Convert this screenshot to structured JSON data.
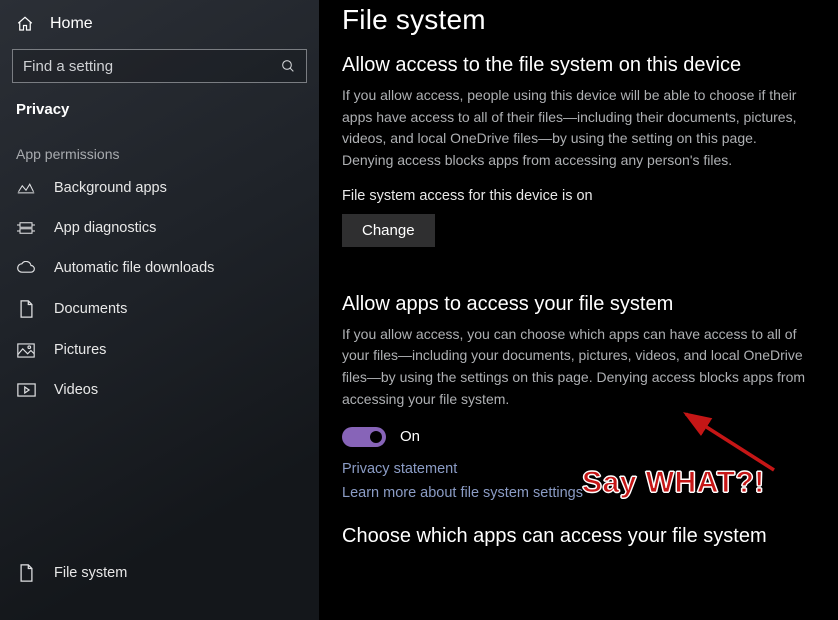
{
  "sidebar": {
    "home": "Home",
    "search_placeholder": "Find a setting",
    "category": "Privacy",
    "group": "App permissions",
    "items": [
      {
        "label": "Background apps",
        "icon": "background-apps-icon"
      },
      {
        "label": "App diagnostics",
        "icon": "diagnostics-icon"
      },
      {
        "label": "Automatic file downloads",
        "icon": "cloud-icon"
      },
      {
        "label": "Documents",
        "icon": "document-icon"
      },
      {
        "label": "Pictures",
        "icon": "pictures-icon"
      },
      {
        "label": "Videos",
        "icon": "videos-icon"
      }
    ],
    "selected": {
      "label": "File system",
      "icon": "document-icon"
    }
  },
  "main": {
    "title": "File system",
    "section1": {
      "heading": "Allow access to the file system on this device",
      "body": "If you allow access, people using this device will be able to choose if their apps have access to all of their files—including their documents, pictures, videos, and local OneDrive files—by using the setting on this page. Denying access blocks apps from accessing any person's files.",
      "status": "File system access for this device is on",
      "button": "Change"
    },
    "section2": {
      "heading": "Allow apps to access your file system",
      "body": "If you allow access, you can choose which apps can have access to all of your files—including your documents, pictures, videos, and local OneDrive files—by using the settings on this page. Denying access blocks apps from accessing your file system.",
      "toggle_label": "On",
      "link_privacy": "Privacy statement",
      "link_learn": "Learn more about file system settings"
    },
    "section3": {
      "heading": "Choose which apps can access your file system"
    }
  },
  "annotation": {
    "text": "Say WHAT?!"
  }
}
